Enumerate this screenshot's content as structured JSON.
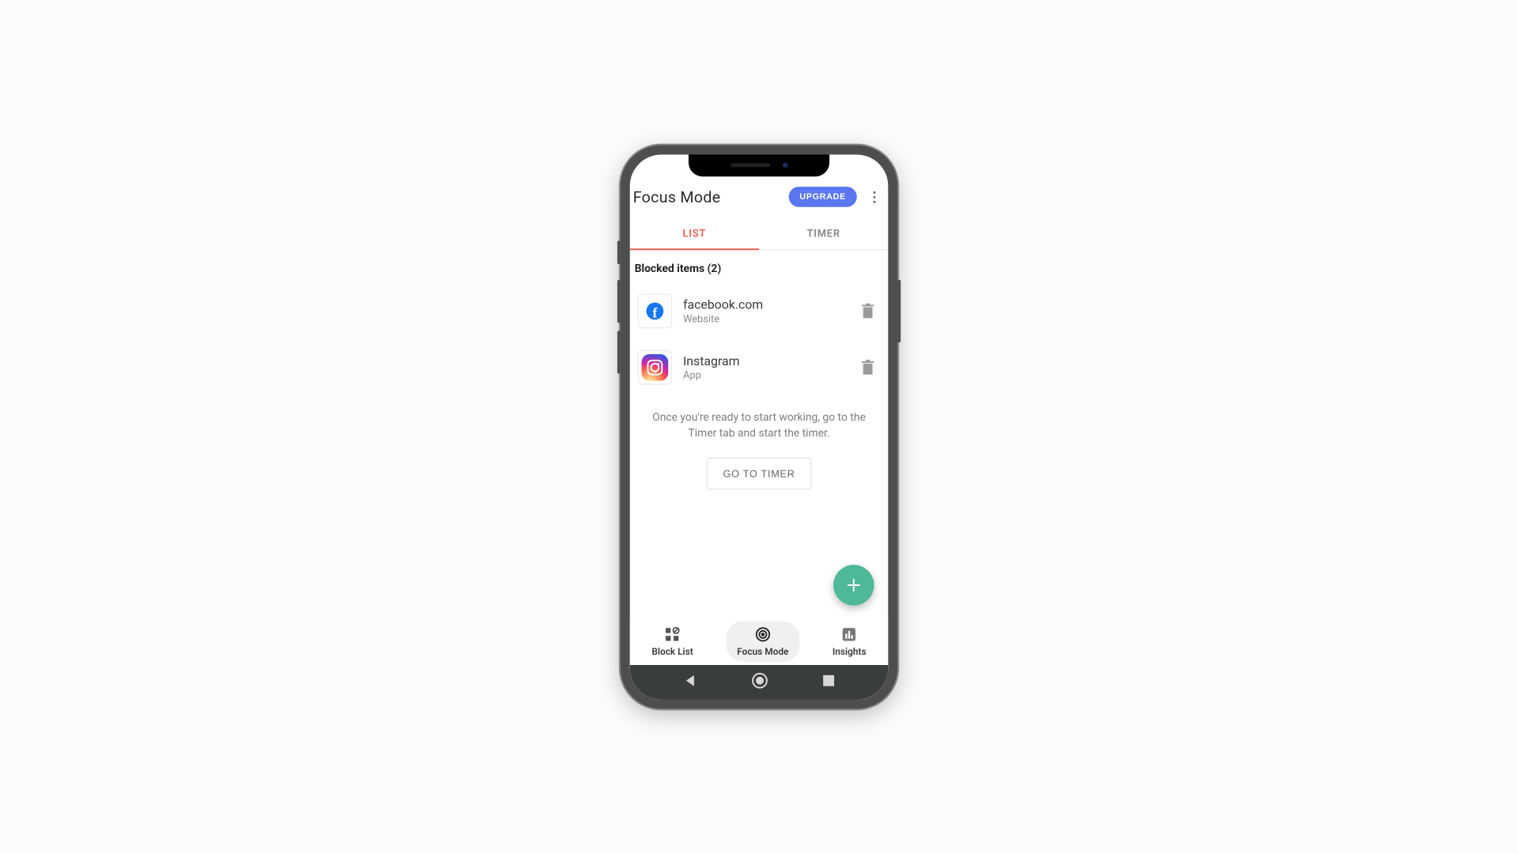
{
  "appbar": {
    "title": "Focus Mode",
    "upgrade_label": "UPGRADE"
  },
  "tabs": [
    {
      "label": "LIST",
      "active": true
    },
    {
      "label": "TIMER",
      "active": false
    }
  ],
  "section": {
    "header": "Blocked items (2)",
    "items": [
      {
        "title": "facebook.com",
        "subtitle": "Website",
        "icon": "facebook"
      },
      {
        "title": "Instagram",
        "subtitle": "App",
        "icon": "instagram"
      }
    ]
  },
  "hint": "Once you're ready to start working, go to the Timer tab and start the timer.",
  "go_timer_label": "GO TO TIMER",
  "bottom_nav": [
    {
      "label": "Block List",
      "icon": "blocklist",
      "active": false
    },
    {
      "label": "Focus Mode",
      "icon": "focusmode",
      "active": true
    },
    {
      "label": "Insights",
      "icon": "insights",
      "active": false
    }
  ]
}
